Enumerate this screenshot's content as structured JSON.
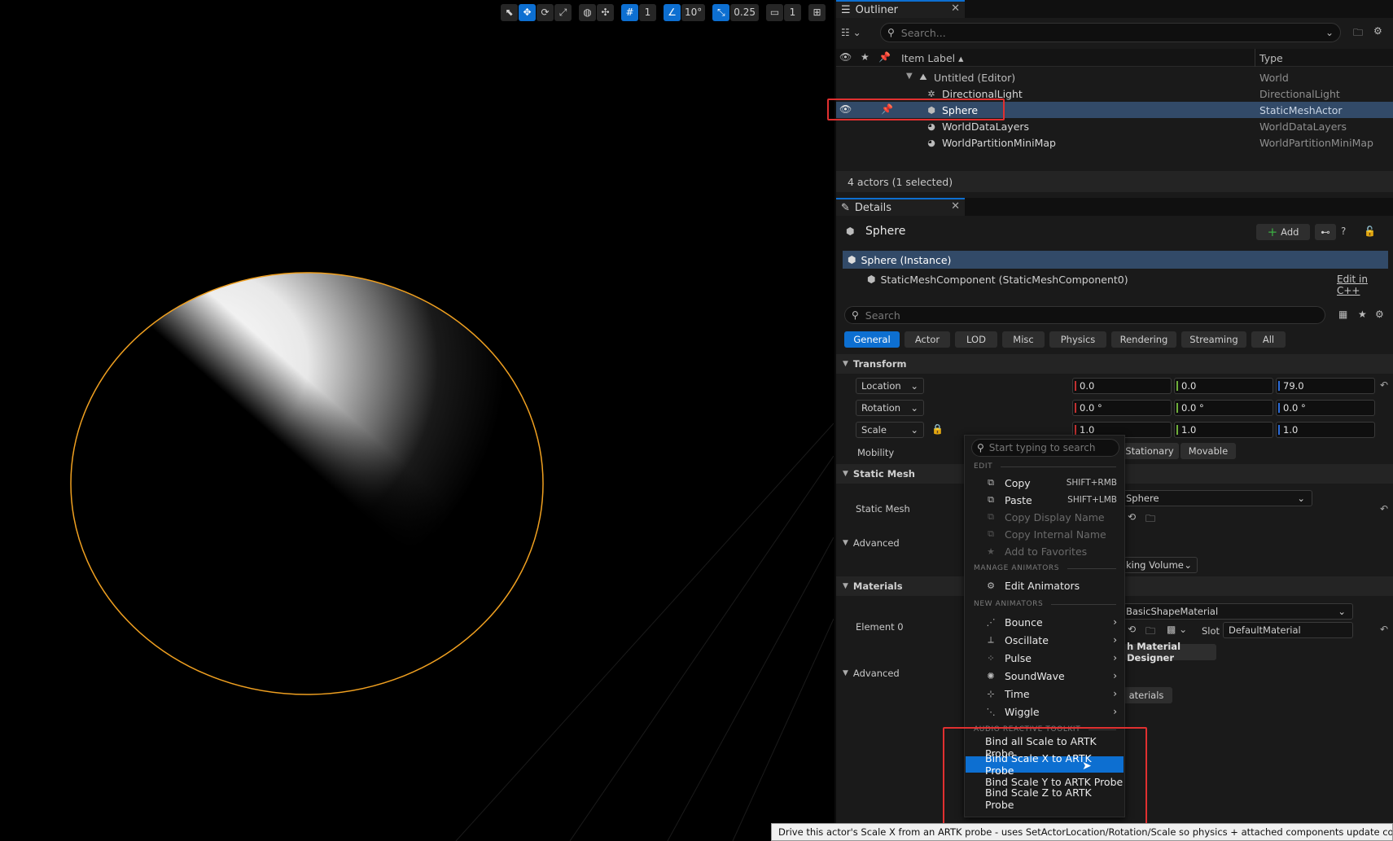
{
  "viewport": {
    "toolbar": {
      "grid_snap": "1",
      "rotation_snap": "10°",
      "scale_snap": "0.25",
      "camera_speed": "1"
    }
  },
  "outliner": {
    "tab_title": "Outliner",
    "search_placeholder": "Search...",
    "col_label": "Item Label ▴",
    "col_type": "Type",
    "items": [
      {
        "label": "Untitled (Editor)",
        "type": "World",
        "icon": "world-icon"
      },
      {
        "label": "DirectionalLight",
        "type": "DirectionalLight",
        "icon": "light-icon"
      },
      {
        "label": "Sphere",
        "type": "StaticMeshActor",
        "icon": "cube-icon",
        "selected": true
      },
      {
        "label": "WorldDataLayers",
        "type": "WorldDataLayers",
        "icon": "sphere-icon"
      },
      {
        "label": "WorldPartitionMiniMap",
        "type": "WorldPartitionMiniMap",
        "icon": "sphere-icon"
      }
    ],
    "status": "4 actors (1 selected)"
  },
  "details": {
    "tab_title": "Details",
    "actor_name": "Sphere",
    "add_label": "Add",
    "instance_label": "Sphere (Instance)",
    "component_label": "StaticMeshComponent (StaticMeshComponent0)",
    "edit_cpp": "Edit in C++",
    "search_placeholder": "Search",
    "filters": [
      "General",
      "Actor",
      "LOD",
      "Misc",
      "Physics",
      "Rendering",
      "Streaming",
      "All"
    ],
    "transform": {
      "section": "Transform",
      "location_label": "Location",
      "rotation_label": "Rotation",
      "scale_label": "Scale",
      "location": [
        "0.0",
        "0.0",
        "79.0"
      ],
      "rotation": [
        "0.0 °",
        "0.0 °",
        "0.0 °"
      ],
      "scale": [
        "1.0",
        "1.0",
        "1.0"
      ],
      "mobility_label": "Mobility",
      "mobility_options": [
        "Stationary",
        "Movable"
      ]
    },
    "static_mesh": {
      "section": "Static Mesh",
      "label": "Static Mesh",
      "value": "Sphere",
      "advanced": "Advanced",
      "nav_volume": "king Volume"
    },
    "materials": {
      "section": "Materials",
      "element_label": "Element 0",
      "value": "BasicShapeMaterial",
      "slot_label": "Slot",
      "slot_value": "DefaultMaterial",
      "designer_btn": "h Material Designer",
      "advanced": "Advanced",
      "materials_btn": "aterials"
    }
  },
  "context_menu": {
    "search_placeholder": "Start typing to search",
    "edit_header": "EDIT",
    "copy": "Copy",
    "copy_shortcut": "SHIFT+RMB",
    "paste": "Paste",
    "paste_shortcut": "SHIFT+LMB",
    "copy_display": "Copy Display Name",
    "copy_internal": "Copy Internal Name",
    "add_fav": "Add to Favorites",
    "manage_header": "MANAGE ANIMATORS",
    "edit_animators": "Edit Animators",
    "new_header": "NEW ANIMATORS",
    "new_animators": [
      "Bounce",
      "Oscillate",
      "Pulse",
      "SoundWave",
      "Time",
      "Wiggle"
    ],
    "artk_header": "AUDIO REACTIVE TOOLKIT",
    "artk_items": [
      "Bind all Scale to ARTK Probe",
      "Bind Scale X to ARTK Probe",
      "Bind Scale Y to ARTK Probe",
      "Bind Scale Z to ARTK Probe"
    ]
  },
  "tooltip": "Drive this actor's Scale X from an ARTK probe - uses SetActorLocation/Rotation/Scale so physics + attached components update correctly.",
  "colors": {
    "accent": "#0d6fd1",
    "highlight": "#e03030",
    "selection_outline": "#f0a020"
  }
}
